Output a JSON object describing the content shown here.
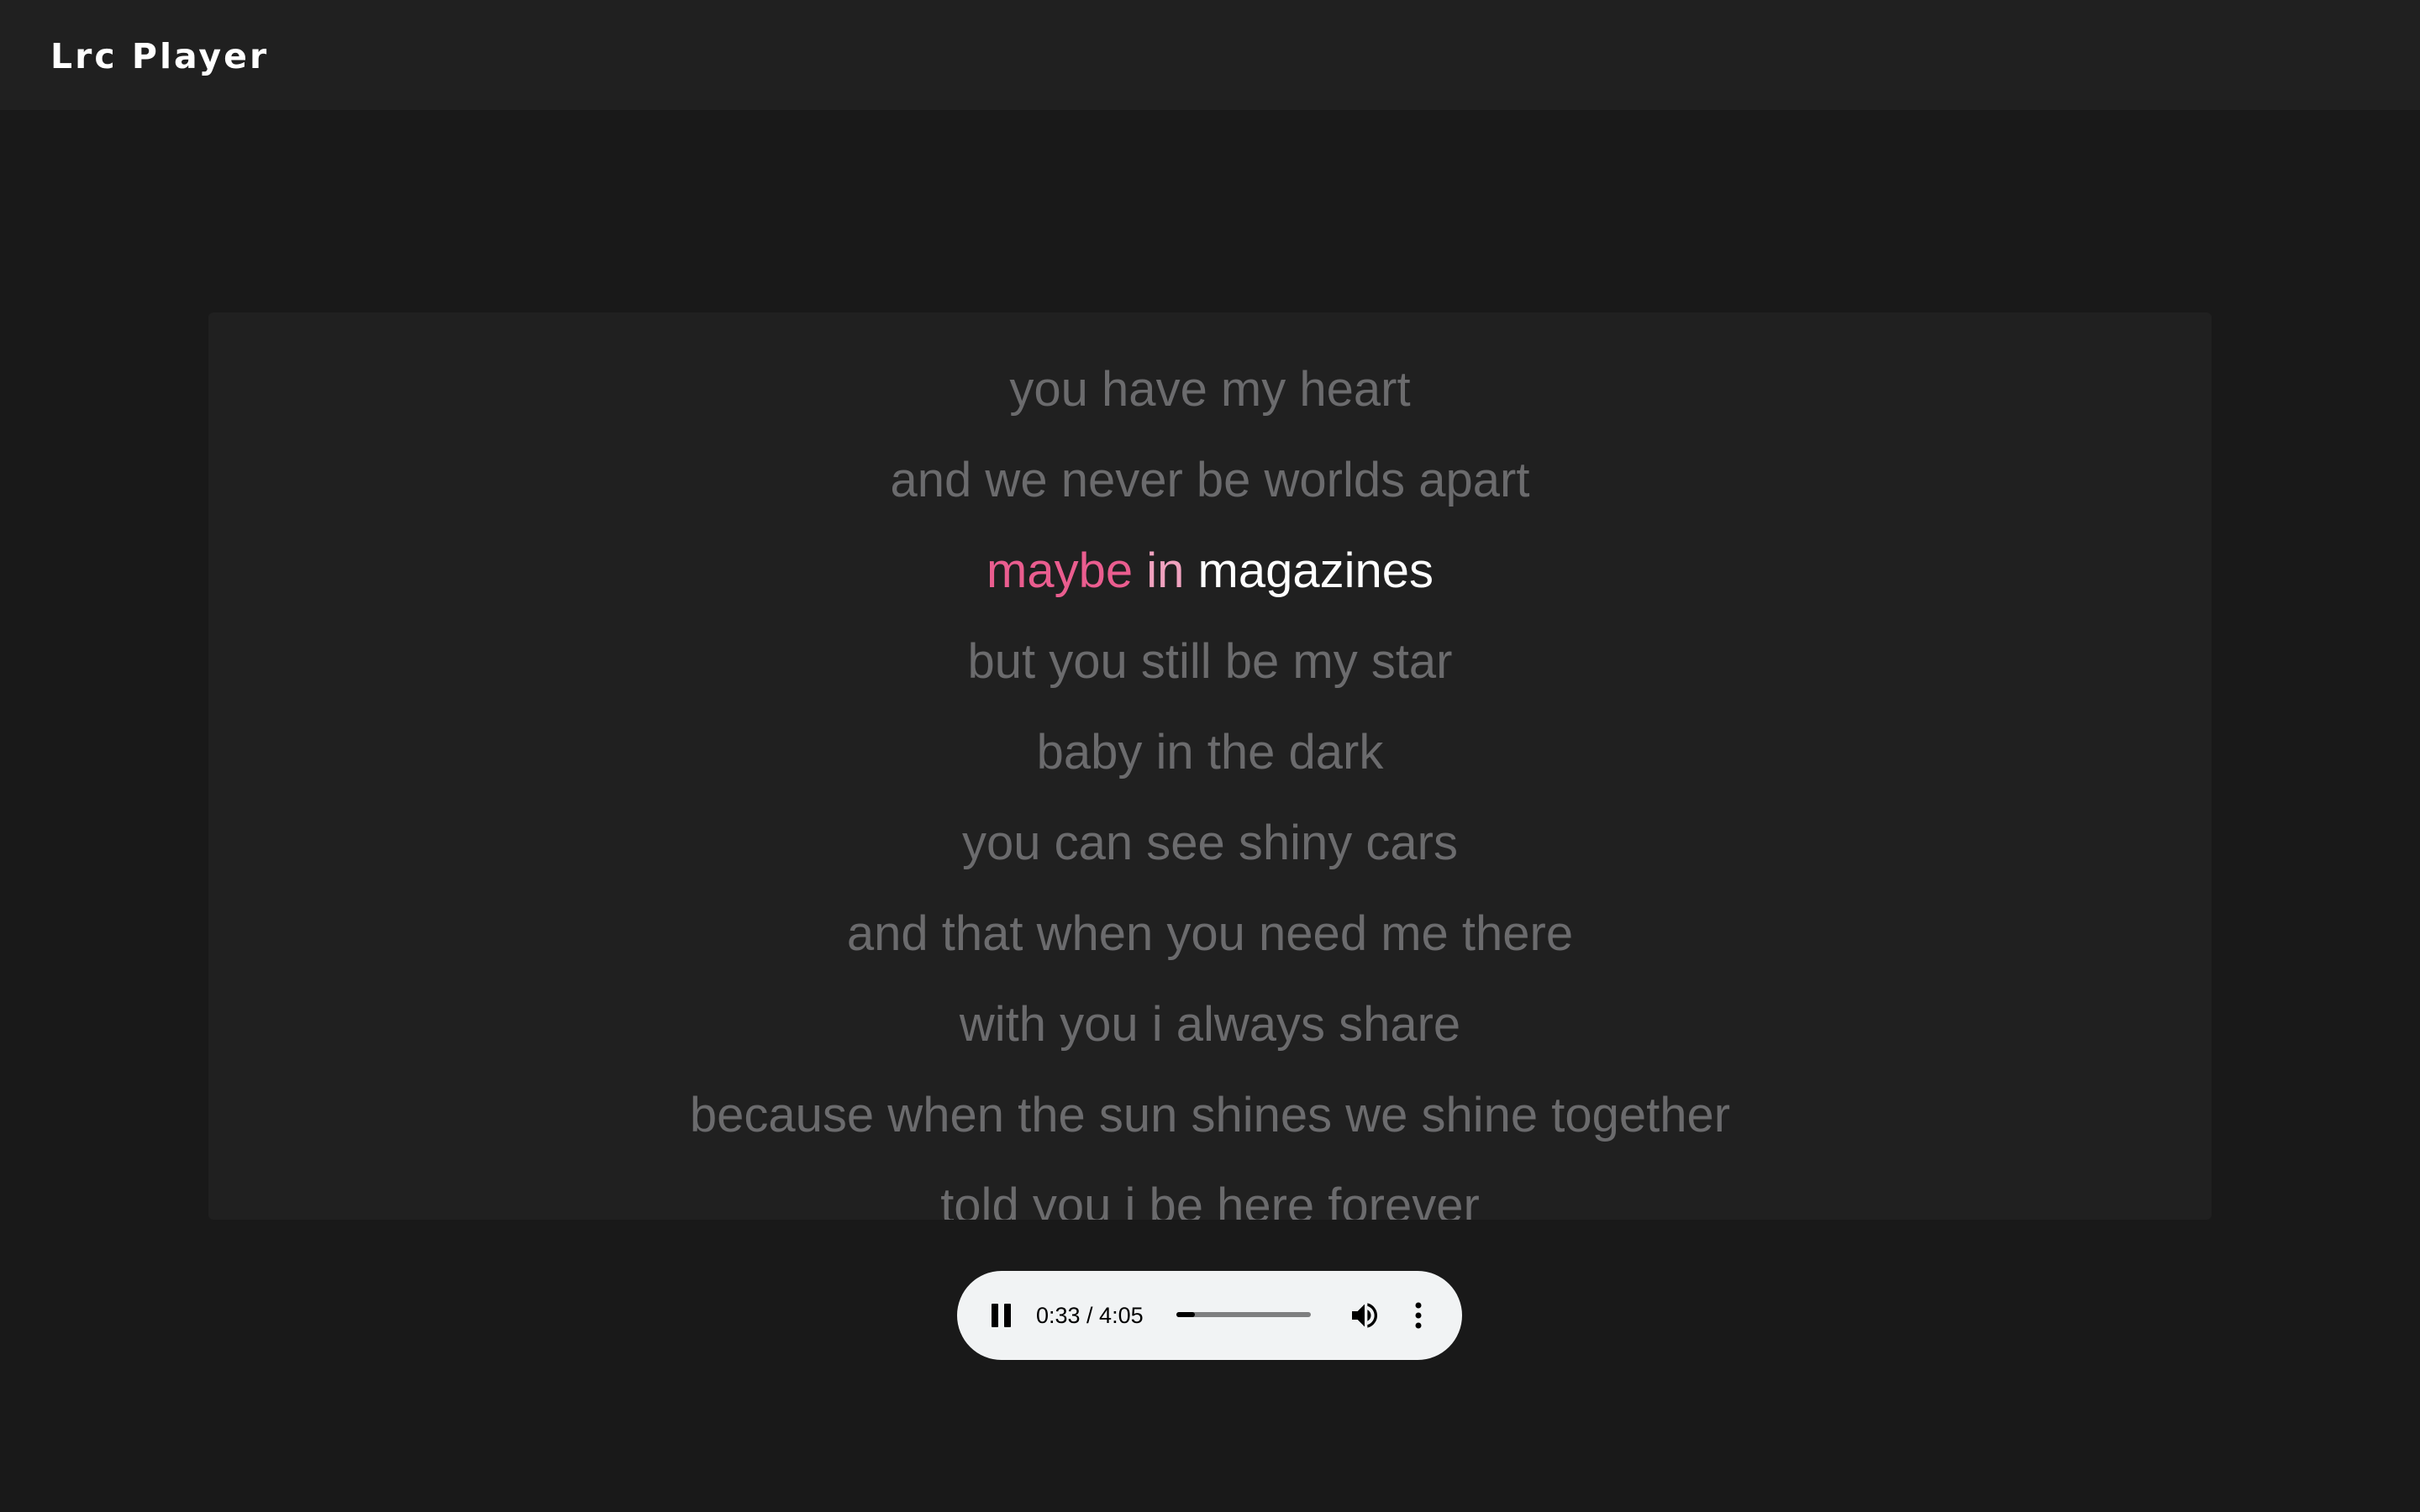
{
  "app": {
    "title": "Lrc Player"
  },
  "lyrics": {
    "lines": [
      "you have my heart",
      "and we never be worlds apart",
      "maybe in magazines",
      "but you still be my star",
      "baby in the dark",
      "you can see shiny cars",
      "and that when you need me there",
      "with you i always share",
      "because when the sun shines we shine together",
      "told you i be here forever"
    ],
    "active_line": {
      "index": 2,
      "words": [
        {
          "text": "maybe",
          "state": "sung"
        },
        {
          "text": "in",
          "state": "partial"
        },
        {
          "text": "magazines",
          "state": "upcoming"
        }
      ]
    }
  },
  "player": {
    "state": "playing",
    "pause_icon": "pause-icon",
    "time_text": "0:33 / 4:05",
    "progress_fraction": 0.135,
    "volume_icon": "volume-icon",
    "more_icon": "more-vertical-icon"
  },
  "colors": {
    "background": "#191919",
    "header": "#202020",
    "panel": "#202020",
    "lyric_inactive": "#6b6b6d",
    "lyric_active": "#ffffff",
    "sung": "#ea5d8f",
    "partial": "#f0a2bf",
    "player_bg": "#f1f3f4"
  }
}
